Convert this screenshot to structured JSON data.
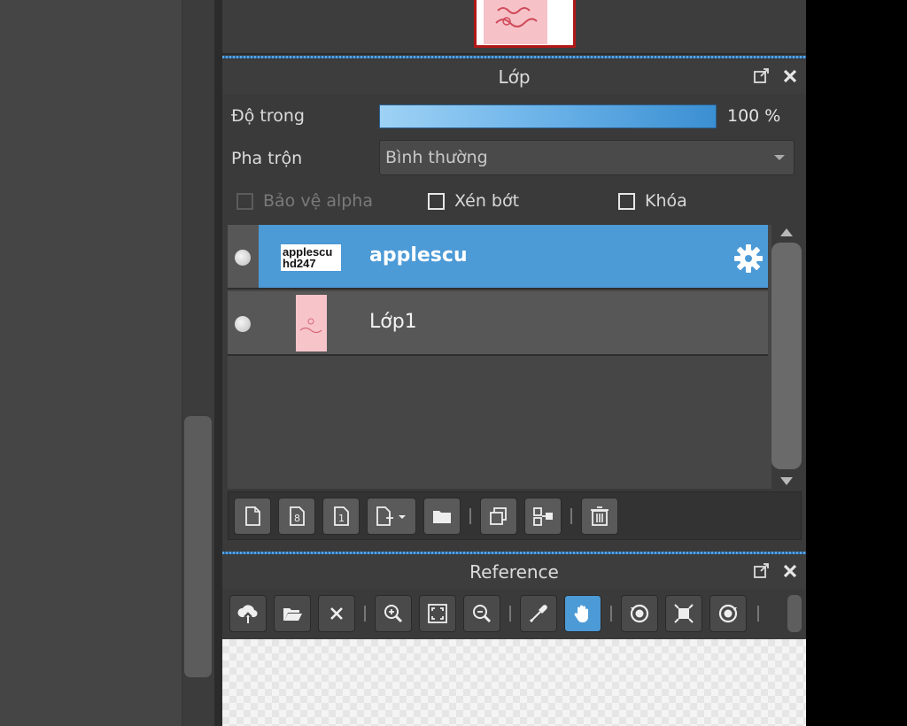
{
  "layers_panel": {
    "title": "Lớp",
    "opacity_label": "Độ trong",
    "opacity_value": "100 %",
    "opacity_fraction": 1.0,
    "blend_label": "Pha trộn",
    "blend_value": "Bình thường",
    "protect_alpha_label": "Bảo vệ alpha",
    "clipping_label": "Xén bớt",
    "lock_label": "Khóa",
    "layers": [
      {
        "name": "applescu",
        "thumb_text": "applescu hd247",
        "selected": true
      },
      {
        "name": "Lớp1",
        "selected": false
      }
    ]
  },
  "reference_panel": {
    "title": "Reference"
  },
  "colors": {
    "accent": "#4c9ad6",
    "panel_bg": "#3a3a3a",
    "navigator_frame": "#b01818"
  }
}
